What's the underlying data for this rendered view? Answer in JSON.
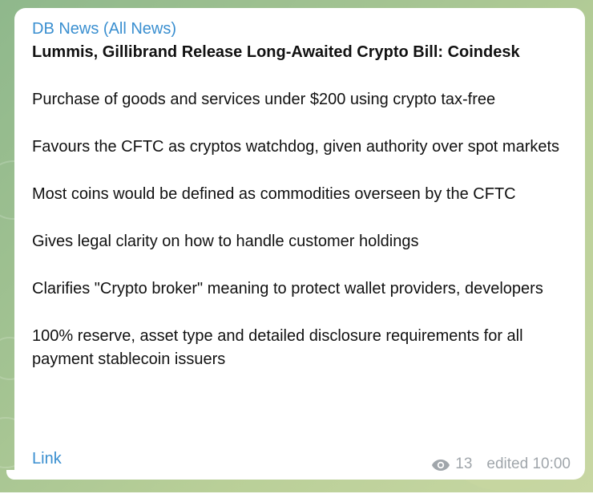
{
  "message": {
    "channel": "DB News (All News)",
    "headline": "Lummis, Gillibrand Release Long-Awaited Crypto Bill: Coindesk",
    "paragraphs": [
      "Purchase of goods and services under $200 using crypto tax-free",
      "Favours the CFTC as cryptos watchdog, given authority over spot markets",
      "Most coins would be defined as commodities overseen by the CFTC",
      "Gives legal clarity on how to handle customer holdings",
      "Clarifies \"Crypto broker\" meaning to protect wallet providers, developers",
      "100% reserve, asset type and detailed disclosure requirements for all payment stablecoin issuers"
    ],
    "link_label": "Link",
    "views": "13",
    "edited": "edited 10:00",
    "views_icon": "eye-icon"
  },
  "colors": {
    "accent": "#3a8fd0",
    "meta": "#a0a6ab",
    "bubble": "#ffffff"
  }
}
